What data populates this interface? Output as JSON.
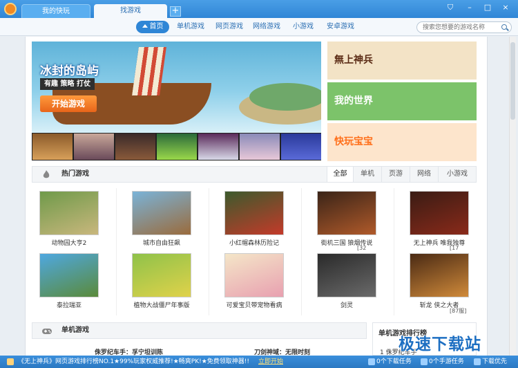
{
  "tabs": {
    "my_games": "我的快玩",
    "find_games": "找游戏",
    "add": "+"
  },
  "window_controls": [
    "⛉",
    "–",
    "□",
    "×"
  ],
  "nav": {
    "home": "首页",
    "items": [
      "单机游戏",
      "网页游戏",
      "网络游戏",
      "小游戏",
      "安卓游戏"
    ]
  },
  "search": {
    "placeholder": "搜索您想要的游戏名称"
  },
  "banner": {
    "title": "冰封的岛屿",
    "subtitle": "有趣 策略 打仗",
    "button": "开始游戏"
  },
  "promos": [
    {
      "label": "無上神兵",
      "color": "#5a2a14",
      "bg": "#f3e3c6"
    },
    {
      "label": "我的世界",
      "color": "#ffffff",
      "bg": "#7cc36a"
    },
    {
      "label": "快玩宝宝",
      "color": "#ff6f1a",
      "bg": "#fde5cc"
    }
  ],
  "hot": {
    "title": "热门游戏",
    "tabs": [
      "全部",
      "单机",
      "页游",
      "网络",
      "小游戏"
    ],
    "games": [
      {
        "name": "动物园大亨2",
        "colors": [
          "#6f9a4a",
          "#c9b77d"
        ]
      },
      {
        "name": "城市自由狂飙",
        "colors": [
          "#7ab3d8",
          "#9a6b3c"
        ]
      },
      {
        "name": "小红帽森林历险记",
        "colors": [
          "#3c5a2c",
          "#c43a2a"
        ]
      },
      {
        "name": "街机三国 狼烟传说",
        "extra": "[32",
        "colors": [
          "#3a2418",
          "#b05a2a"
        ]
      },
      {
        "name": "无上神兵 唯我独尊",
        "extra": "[17",
        "colors": [
          "#3a1c14",
          "#8a2a1a"
        ]
      },
      {
        "name": "泰拉瑞亚",
        "colors": [
          "#4fa8e0",
          "#5a8a3a"
        ]
      },
      {
        "name": "植物大战僵尸年事版",
        "colors": [
          "#8fc24a",
          "#e0d24a"
        ]
      },
      {
        "name": "可爱宝贝带宠物看病",
        "colors": [
          "#f4e6c8",
          "#e8a0b0"
        ]
      },
      {
        "name": "剑灵",
        "colors": [
          "#2a2a2a",
          "#6a6a6a"
        ]
      },
      {
        "name": "斩龙 侠之大者",
        "extra": "[87服]",
        "colors": [
          "#4a2a14",
          "#d08a3a"
        ]
      }
    ]
  },
  "single": {
    "title": "单机游戏"
  },
  "ranking": {
    "title": "单机游戏排行榜"
  },
  "partial_titles": [
    "侏罗纪车手：孚宁坦训陈",
    "刀剑神域：无限时刻",
    "1 侏罗纪车手"
  ],
  "watermark": "极速下载站",
  "statusbar": {
    "ticker": "《无上神兵》网页游戏排行榜NO.1★99%玩家权威推荐!★畅爽PK!★免费领取神器!!",
    "start": "立即开始",
    "downloads": "0个下载任务",
    "mobile": "0个手游任务",
    "priority": "下载优先"
  }
}
